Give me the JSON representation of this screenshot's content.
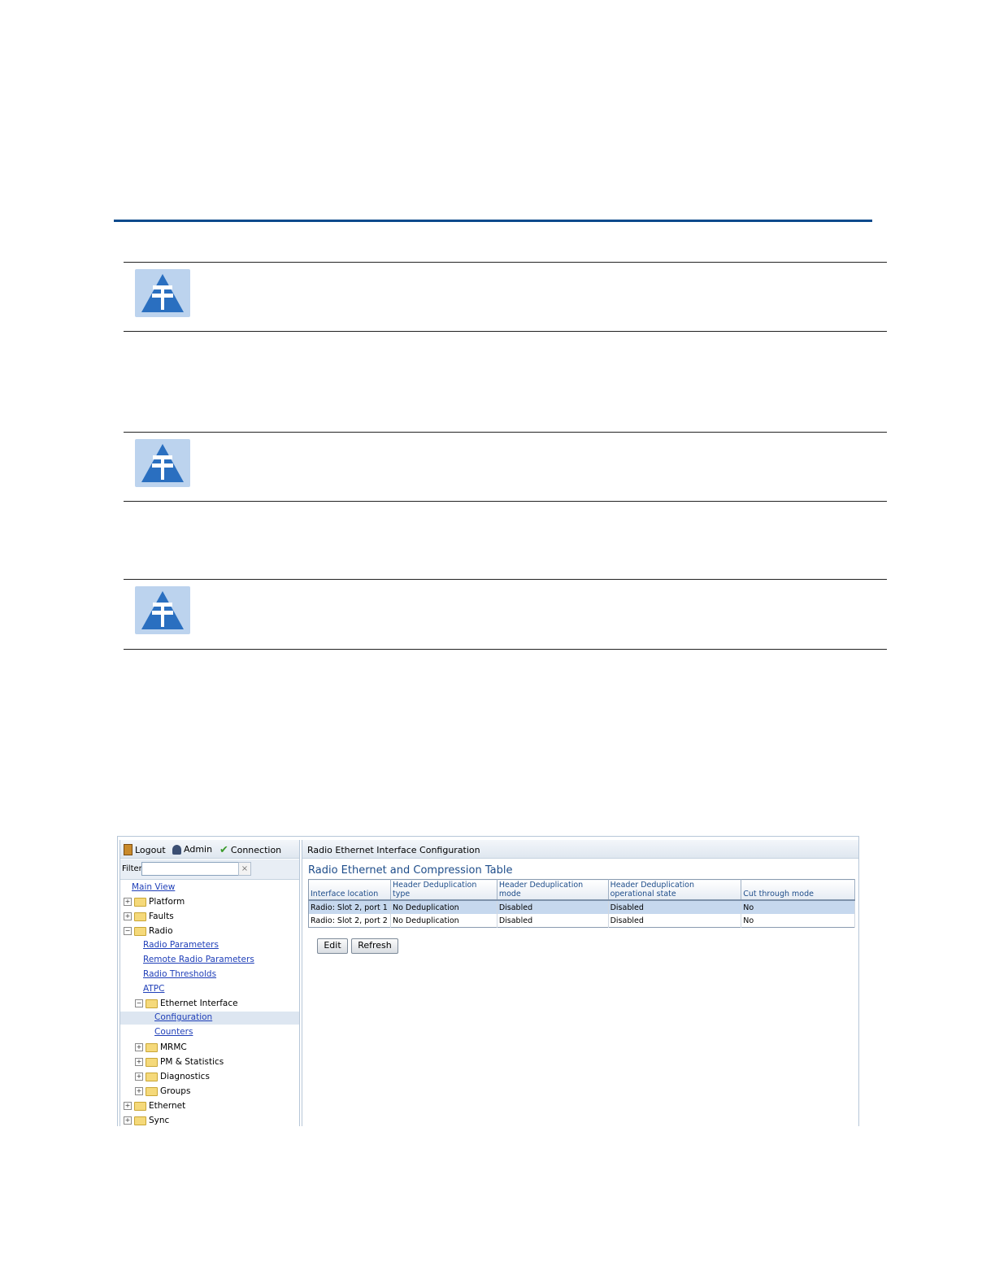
{
  "screenshot": {
    "toolbar": {
      "logout": "Logout",
      "admin": "Admin",
      "connection": "Connection"
    },
    "filter": {
      "label": "Filter",
      "value": "",
      "clear": "×"
    },
    "tree": {
      "main_view": "Main View",
      "platform": "Platform",
      "faults": "Faults",
      "radio": "Radio",
      "radio_parameters": "Radio Parameters",
      "remote_radio_parameters": "Remote Radio Parameters",
      "radio_thresholds": "Radio Thresholds",
      "atpc": "ATPC",
      "ethernet_interface": "Ethernet Interface",
      "configuration": "Configuration",
      "counters": "Counters",
      "mrmc": "MRMC",
      "pm_statistics": "PM & Statistics",
      "diagnostics": "Diagnostics",
      "groups": "Groups",
      "ethernet": "Ethernet",
      "sync": "Sync"
    },
    "panel_title": "Radio Ethernet Interface Configuration",
    "table_title": "Radio Ethernet and Compression Table",
    "columns": [
      "Interface location",
      "Header Deduplication type",
      "Header Deduplication mode",
      "Header Deduplication operational state",
      "Cut through mode"
    ],
    "rows": [
      [
        "Radio: Slot 2, port 1",
        "No Deduplication",
        "Disabled",
        "Disabled",
        "No"
      ],
      [
        "Radio: Slot 2, port 2",
        "No Deduplication",
        "Disabled",
        "Disabled",
        "No"
      ]
    ],
    "buttons": {
      "edit": "Edit",
      "refresh": "Refresh"
    }
  },
  "colors": {
    "rule": "#0b4a8c",
    "note_icon_bg": "#bcd3ee",
    "note_icon_fg": "#2a6fc0",
    "selected_row": "#c6d8ee",
    "link": "#1f3fb8"
  }
}
